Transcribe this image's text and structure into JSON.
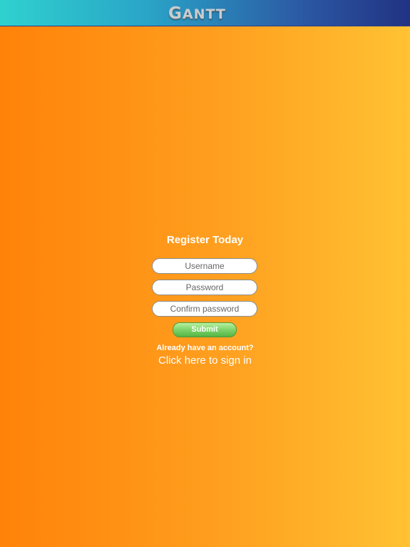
{
  "header": {
    "logo_text_first": "G",
    "logo_text_rest": "ANTT",
    "logo_icon": "gantt-logo"
  },
  "register": {
    "title": "Register Today",
    "username_placeholder": "Username",
    "password_placeholder": "Password",
    "confirm_password_placeholder": "Confirm password",
    "submit_label": "Submit",
    "already_text": "Already have an account?",
    "signin_link": "Click here to sign in"
  },
  "colors": {
    "header_start": "#2fd1cf",
    "header_end": "#213382",
    "background_start": "#ff8209",
    "background_end": "#ffc233",
    "submit_green": "#7ed36a"
  }
}
